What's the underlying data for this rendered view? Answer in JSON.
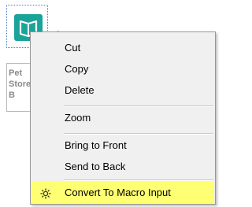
{
  "tool": {
    "label": "Pet Store B",
    "icon": "book-icon",
    "icon_color": "#1aa399",
    "anchor_color": "#b5cf8e"
  },
  "context_menu": {
    "items": [
      {
        "label": "Cut"
      },
      {
        "label": "Copy"
      },
      {
        "label": "Delete"
      },
      {
        "label": "Zoom"
      },
      {
        "label": "Bring to Front"
      },
      {
        "label": "Send to Back"
      },
      {
        "label": "Convert To Macro Input",
        "icon": "gear-icon",
        "highlight_color": "#ffff73"
      }
    ]
  }
}
